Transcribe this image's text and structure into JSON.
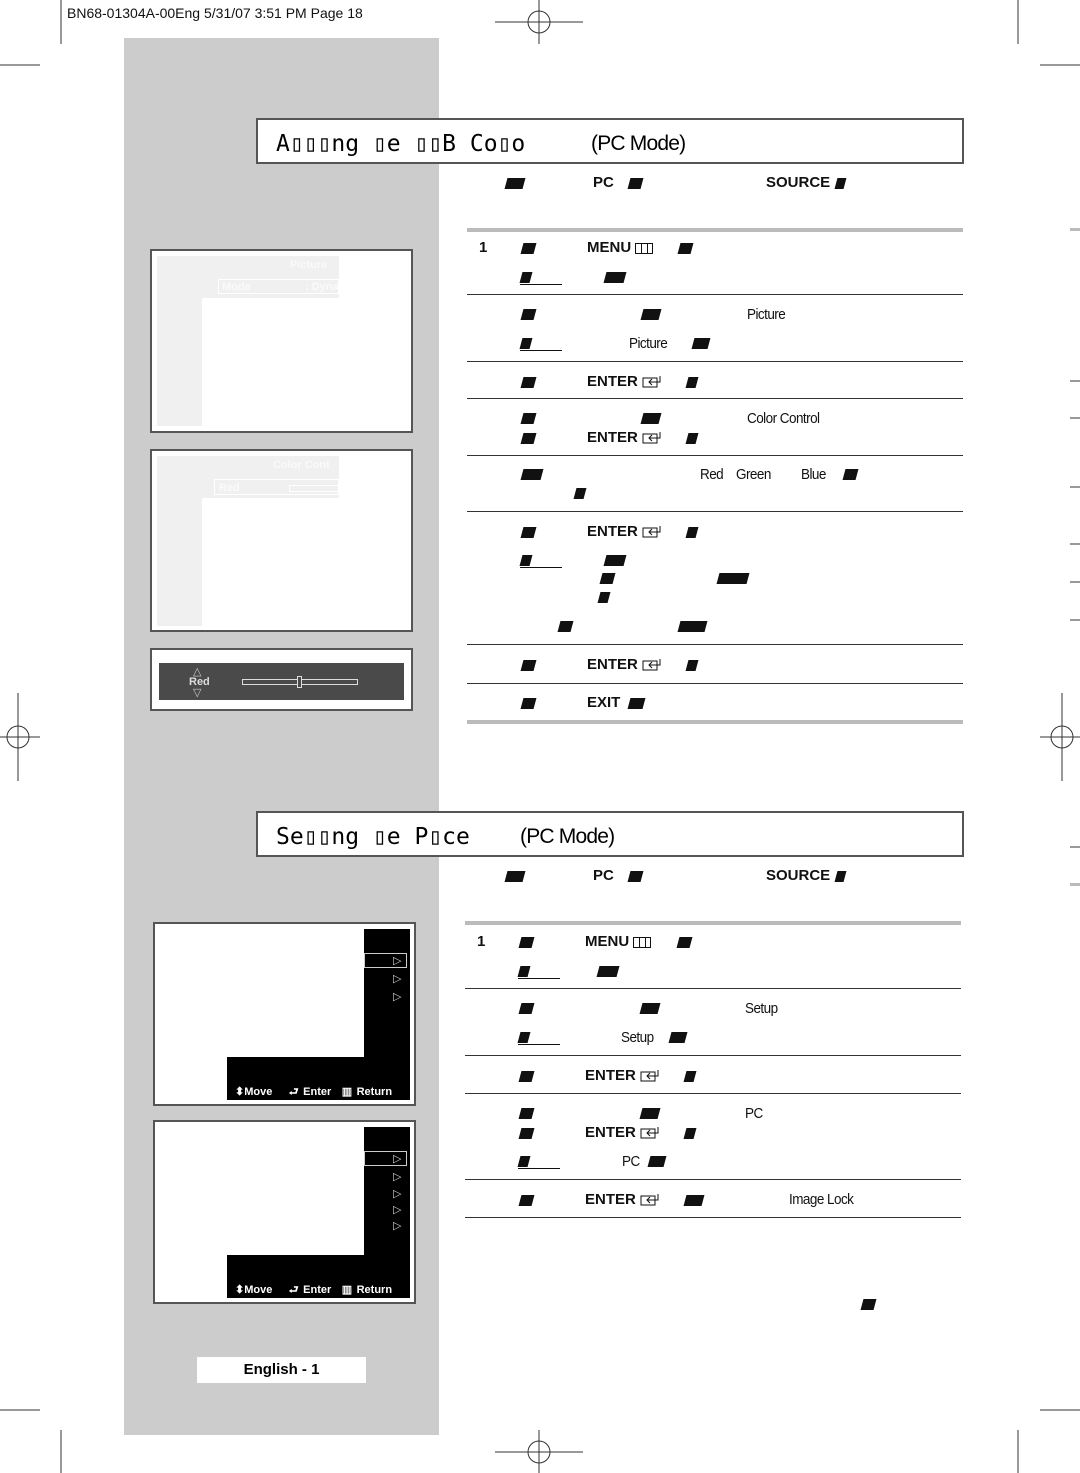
{
  "print_header": "BN68-01304A-00Eng  5/31/07  3:51 PM  Page 18",
  "section1": {
    "title": "A▯▯▯ng ▯e ▯▯B Co▯o",
    "title_mode": "(PC Mode)",
    "pc": "PC",
    "source": "SOURCE",
    "step1": "1",
    "menu": "MENU",
    "picture": "Picture",
    "picture2": "Picture",
    "enter": "ENTER",
    "color_control": "Color Control",
    "red": "Red",
    "green": "Green",
    "blue": "Blue",
    "exit": "EXIT",
    "screen1": {
      "title": "Picture",
      "mode_label": "Mode",
      "mode_value": ": Dyna"
    },
    "screen2": {
      "title": "Color Cont",
      "item": "Red"
    },
    "screen3": {
      "label": "Red",
      "slider_value_percent": 50
    }
  },
  "section2": {
    "title": "Se▯▯ng ▯e P▯ce",
    "title_mode": "(PC Mode)",
    "pc": "PC",
    "source": "SOURCE",
    "step1": "1",
    "menu": "MENU",
    "setup": "Setup",
    "setup2": "Setup",
    "enter": "ENTER",
    "pc_item": "PC",
    "pc_item2": "PC",
    "image_lock": "Image Lock",
    "osd": {
      "move": "Move",
      "enter": "Enter",
      "return": "Return"
    }
  },
  "footer": {
    "page_label": "English - 1"
  },
  "colors": {
    "sidebar": "#cccccc",
    "osd_dark": "#4a4a4a",
    "osd_black": "#000000"
  }
}
